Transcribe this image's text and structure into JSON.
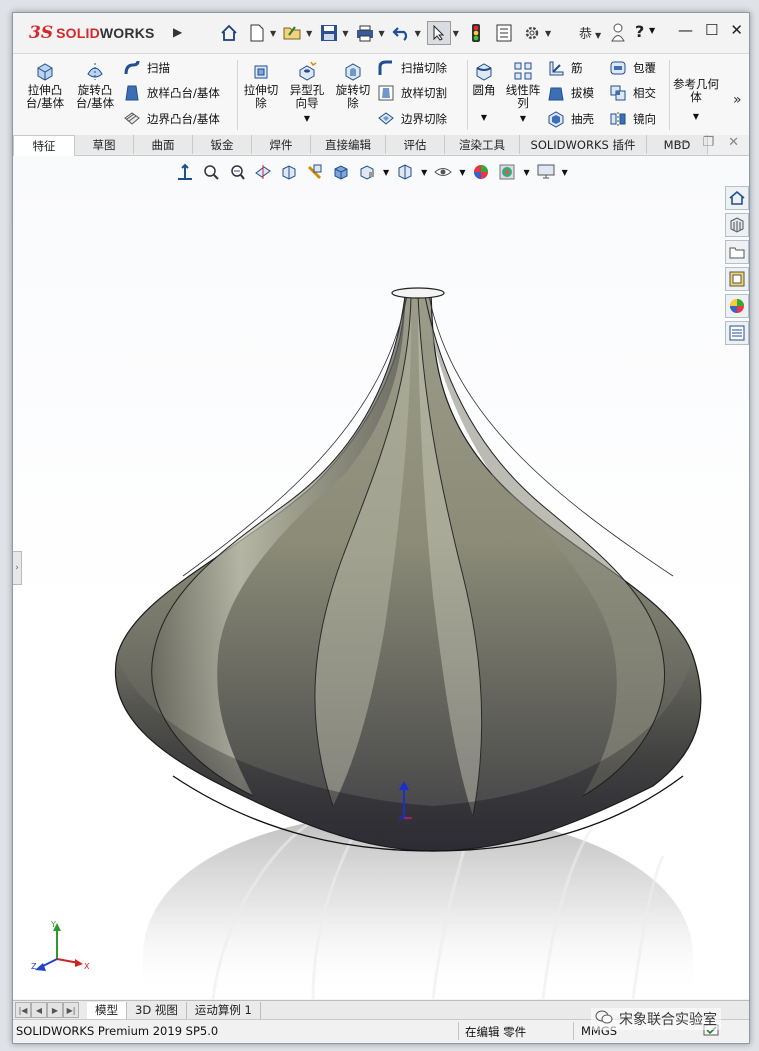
{
  "app": {
    "logo_ds": "3S",
    "logo_solid": "SOLID",
    "logo_works": "WORKS",
    "user_label": "恭"
  },
  "ribbon": {
    "extrude_boss": "拉伸凸台/基体",
    "revolve_boss": "旋转凸台/基体",
    "sweep": "扫描",
    "loft_boss": "放样凸台/基体",
    "boundary_boss": "边界凸台/基体",
    "extrude_cut": "拉伸切除",
    "hole_wizard": "异型孔向导",
    "revolve_cut": "旋转切除",
    "swept_cut": "扫描切除",
    "lofted_cut": "放样切割",
    "boundary_cut": "边界切除",
    "fillet": "圆角",
    "linear_pattern": "线性阵列",
    "rib": "筋",
    "wrap": "包覆",
    "draft": "拔模",
    "intersect": "相交",
    "shell": "抽壳",
    "mirror": "镜向",
    "reference_geometry": "参考几何体",
    "more": "»"
  },
  "tabs": [
    "特征",
    "草图",
    "曲面",
    "钣金",
    "焊件",
    "直接编辑",
    "评估",
    "渲染工具",
    "SOLIDWORKS 插件",
    "MBD"
  ],
  "active_tab": "特征",
  "sheet_tabs": [
    "模型",
    "3D 视图",
    "运动算例 1"
  ],
  "active_sheet_tab": "模型",
  "status": {
    "product": "SOLIDWORKS Premium 2019 SP5.0",
    "mode": "在编辑 零件",
    "units": "MMGS"
  },
  "watermark": "宋象联合实验室",
  "triad": {
    "x": "X",
    "y": "Y",
    "z": "Z"
  },
  "colors": {
    "brand_red": "#d4282a",
    "model_body": "#8a8a78",
    "viewport_bg": "#ffffff"
  }
}
